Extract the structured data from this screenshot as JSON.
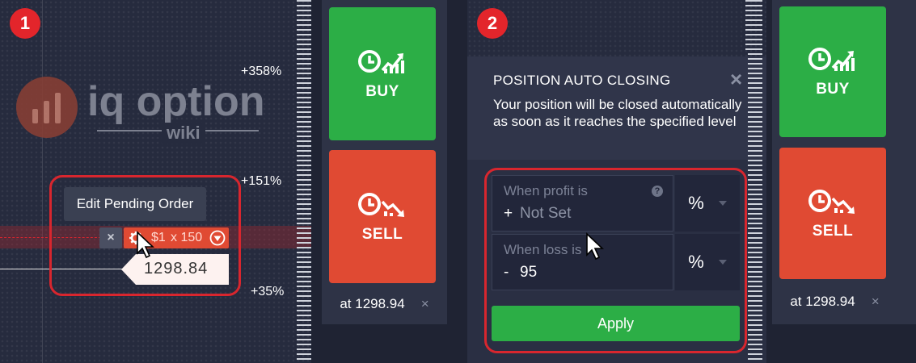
{
  "panel1": {
    "step_badge": "1",
    "logo": {
      "brand": "iq option",
      "sub": "wiki"
    },
    "scale_labels": [
      "+358%",
      "+151%",
      "+35%"
    ],
    "tooltip": "Edit Pending Order",
    "order_close": "×",
    "order_amount": "$1",
    "order_mult": "x 150",
    "price_tag": "1298.84",
    "colors": {
      "accent_red": "#e3252b",
      "buy": "#2cae46",
      "sell": "#e04a33"
    },
    "icons": [
      "gear-icon",
      "cursor-icon",
      "chevron-down-icon"
    ]
  },
  "trade1": {
    "buy_label": "BUY",
    "sell_label": "SELL",
    "at_text": "at 1298.94",
    "close": "×"
  },
  "panel2": {
    "step_badge": "2",
    "dialog": {
      "title": "POSITION AUTO CLOSING",
      "close": "×",
      "description": "Your position will be closed automatically as soon as it reaches the specified level",
      "profit": {
        "label": "When profit is",
        "help": "?",
        "value_sign": "+",
        "value": "Not Set",
        "unit": "%"
      },
      "loss": {
        "label": "When loss is",
        "value_sign": "-",
        "value": "95",
        "unit": "%"
      },
      "apply_label": "Apply"
    }
  },
  "trade2": {
    "buy_label": "BUY",
    "sell_label": "SELL",
    "at_text": "at 1298.94",
    "close": "×"
  }
}
